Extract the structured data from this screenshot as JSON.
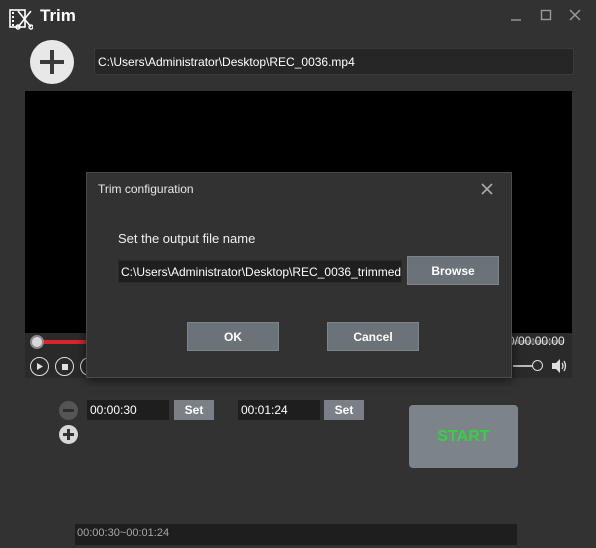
{
  "window": {
    "title": "Trim",
    "icon": "film-scissors-icon",
    "controls": [
      "minimize-icon",
      "maximize-icon",
      "close-icon"
    ]
  },
  "file": {
    "add_icon": "plus-icon",
    "path": "C:\\Users\\Administrator\\Desktop\\REC_0036.mp4"
  },
  "player": {
    "time_display": "0/00:00:00",
    "buttons": [
      "play-icon",
      "stop-icon",
      "loop-icon"
    ],
    "volume_icon": "speaker-icon",
    "seek_progress": 0.0,
    "seek_color": "#d6262b"
  },
  "dialog": {
    "title": "Trim configuration",
    "label": "Set the output file name",
    "output_path": "C:\\Users\\Administrator\\Desktop\\REC_0036_trimmed",
    "browse_label": "Browse",
    "ok_label": "OK",
    "cancel_label": "Cancel"
  },
  "trim": {
    "start_time": "00:00:30",
    "end_time": "00:01:24",
    "set_label": "Set",
    "start_label": "START",
    "start_color": "#32d43c",
    "range_text": "00:00:30~00:01:24"
  }
}
